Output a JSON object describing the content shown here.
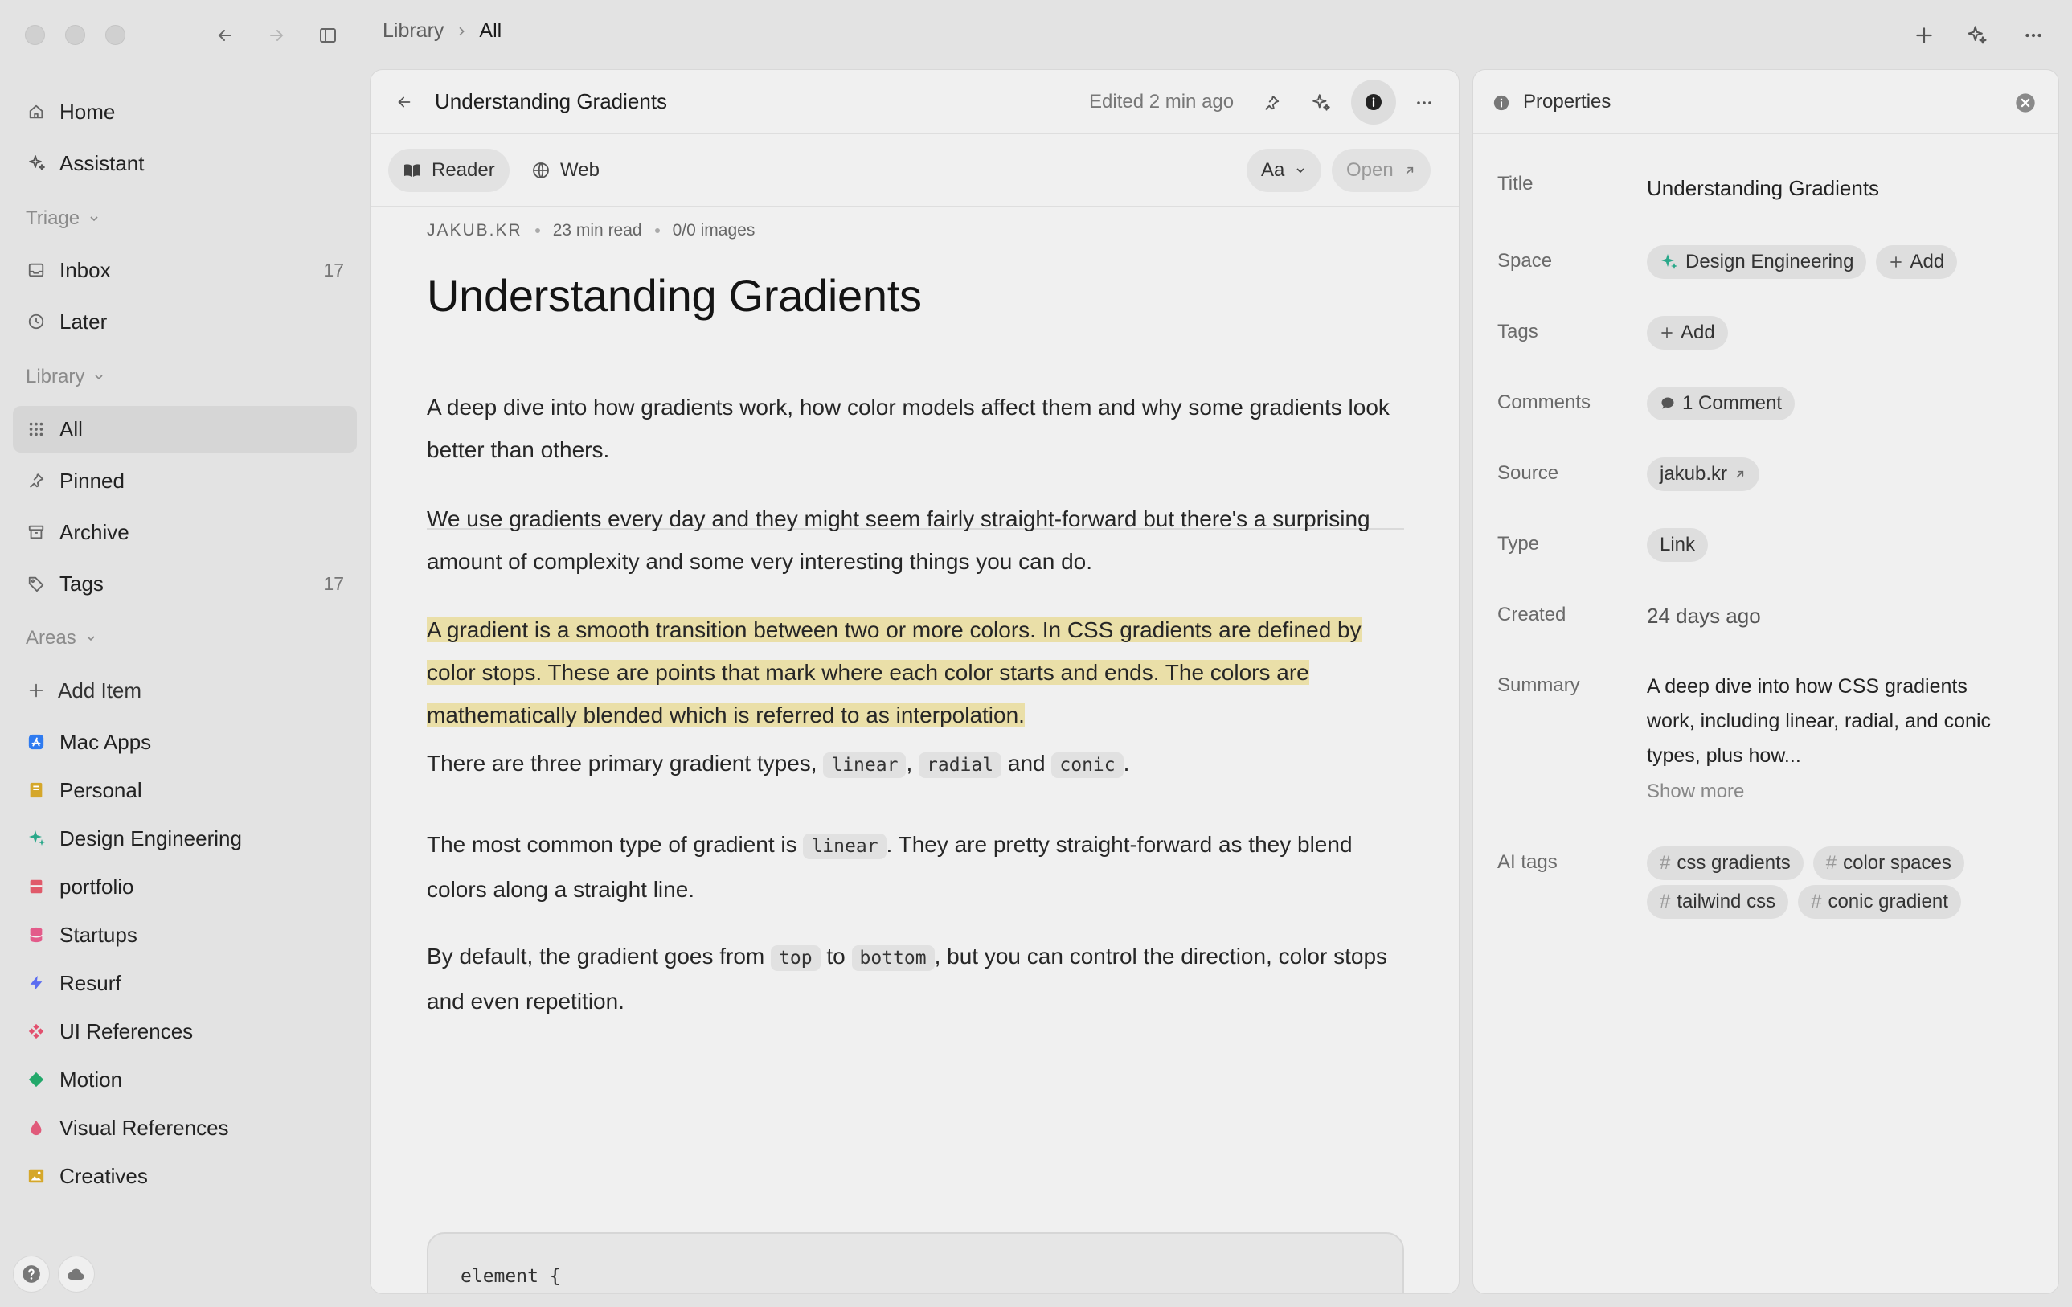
{
  "breadcrumb": {
    "parent": "Library",
    "current": "All"
  },
  "sidebar": {
    "top": [
      {
        "label": "Home",
        "icon": "home-icon"
      },
      {
        "label": "Assistant",
        "icon": "sparkle-icon"
      }
    ],
    "triage_label": "Triage",
    "triage": [
      {
        "label": "Inbox",
        "count": "17",
        "icon": "inbox-icon"
      },
      {
        "label": "Later",
        "count": "",
        "icon": "clock-icon"
      }
    ],
    "library_label": "Library",
    "library": [
      {
        "label": "All",
        "count": "",
        "icon": "grid-icon"
      },
      {
        "label": "Pinned",
        "count": "",
        "icon": "pin-icon"
      },
      {
        "label": "Archive",
        "count": "",
        "icon": "archive-icon"
      },
      {
        "label": "Tags",
        "count": "17",
        "icon": "tag-icon"
      }
    ],
    "areas_label": "Areas",
    "add_item": "Add Item",
    "areas": [
      {
        "label": "Mac Apps",
        "color": "#2f7bf0",
        "icon": "app-store-icon"
      },
      {
        "label": "Personal",
        "color": "#d5a72a",
        "icon": "notebook-icon"
      },
      {
        "label": "Design Engineering",
        "color": "#2aa88a",
        "icon": "sparkle-icon"
      },
      {
        "label": "portfolio",
        "color": "#e05a6a",
        "icon": "flag-icon"
      },
      {
        "label": "Startups",
        "color": "#e35b8a",
        "icon": "database-icon"
      },
      {
        "label": "Resurf",
        "color": "#5a6cf0",
        "icon": "bolt-icon"
      },
      {
        "label": "UI References",
        "color": "#e2506e",
        "icon": "components-icon"
      },
      {
        "label": "Motion",
        "color": "#22a86a",
        "icon": "diamond-icon"
      },
      {
        "label": "Visual References",
        "color": "#e05a7a",
        "icon": "drop-icon"
      },
      {
        "label": "Creatives",
        "color": "#d5a72a",
        "icon": "image-icon"
      }
    ]
  },
  "reader": {
    "title": "Understanding Gradients",
    "edited": "Edited 2 min ago",
    "mode_reader": "Reader",
    "mode_web": "Web",
    "font_btn": "Aa",
    "open_btn": "Open",
    "meta_source": "JAKUB.KR",
    "meta_read": "23 min read",
    "meta_images": "0/0 images",
    "heading": "Understanding Gradients",
    "p1": "A deep dive into how gradients work, how color models affect them and why some gradients look better than others.",
    "p2": "We use gradients every day and they might seem fairly straight-forward but there's a surprising amount of complexity and some very interesting things you can do.",
    "p3": "A gradient is a smooth transition between two or more colors. In CSS gradients are defined by color stops. These are points that mark where each color starts and ends. The colors are mathematically blended which is referred to as interpolation.",
    "p4_a": "There are three primary gradient types, ",
    "p4_c1": "linear",
    "p4_sep": ", ",
    "p4_c2": "radial",
    "p4_and": " and ",
    "p4_c3": "conic",
    "p4_end": ".",
    "p5_a": "The most common type of gradient is ",
    "p5_c1": "linear",
    "p5_b": ". They are pretty straight-forward as they blend colors along a straight line.",
    "p6_a": "By default, the gradient goes from ",
    "p6_c1": "top",
    "p6_to": " to ",
    "p6_c2": "bottom",
    "p6_b": ", but you can control the direction, color stops and even repetition.",
    "code": "element {"
  },
  "properties": {
    "header": "Properties",
    "title_label": "Title",
    "title_value": "Understanding Gradients",
    "space_label": "Space",
    "space_value": "Design Engineering",
    "add": "Add",
    "tags_label": "Tags",
    "comments_label": "Comments",
    "comments_value": "1 Comment",
    "source_label": "Source",
    "source_value": "jakub.kr",
    "type_label": "Type",
    "type_value": "Link",
    "created_label": "Created",
    "created_value": "24 days ago",
    "summary_label": "Summary",
    "summary_value": "A deep dive into how CSS gradients work, including linear, radial, and conic types, plus how...",
    "show_more": "Show more",
    "ai_tags_label": "AI tags",
    "ai_tags": [
      "css gradients",
      "color spaces",
      "tailwind css",
      "conic gradient"
    ],
    "hash": "#"
  }
}
